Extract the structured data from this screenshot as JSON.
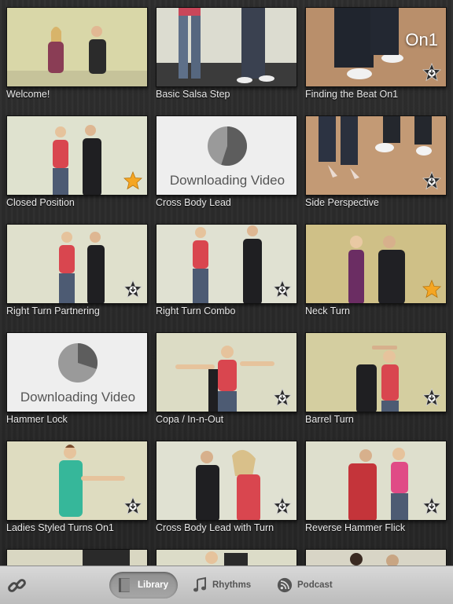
{
  "videos": [
    {
      "title": "Welcome!",
      "badge": "none"
    },
    {
      "title": "Basic Salsa Step",
      "badge": "none"
    },
    {
      "title": "Finding the Beat On1",
      "badge": "download",
      "overlay": "On1"
    },
    {
      "title": "Closed Position",
      "badge": "star"
    },
    {
      "title": "Cross Body Lead",
      "badge": "none",
      "status": "Downloading Video",
      "progress": 0.55
    },
    {
      "title": "Side Perspective",
      "badge": "download"
    },
    {
      "title": "Right Turn Partnering",
      "badge": "download"
    },
    {
      "title": "Right Turn Combo",
      "badge": "download"
    },
    {
      "title": "Neck Turn",
      "badge": "star"
    },
    {
      "title": "Hammer Lock",
      "badge": "none",
      "status": "Downloading Video",
      "progress": 0.3
    },
    {
      "title": "Copa / In-n-Out",
      "badge": "download"
    },
    {
      "title": "Barrel Turn",
      "badge": "download"
    },
    {
      "title": "Ladies Styled Turns On1",
      "badge": "download"
    },
    {
      "title": "Cross Body Lead with Turn",
      "badge": "download"
    },
    {
      "title": "Reverse Hammer Flick",
      "badge": "download"
    }
  ],
  "tabbar": {
    "tabs": [
      {
        "label": "Library",
        "icon": "book-icon",
        "active": true
      },
      {
        "label": "Rhythms",
        "icon": "music-note-icon",
        "active": false
      },
      {
        "label": "Podcast",
        "icon": "rss-icon",
        "active": false
      }
    ],
    "link_icon": "link-icon"
  },
  "colors": {
    "star": "#f5a623",
    "badge_dark": "#2b2b2b"
  }
}
